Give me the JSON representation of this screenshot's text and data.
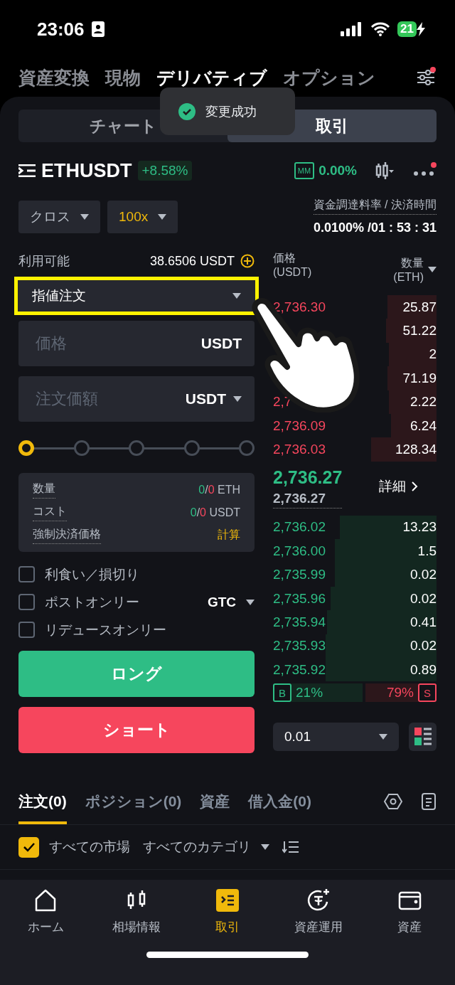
{
  "status_bar": {
    "time": "23:06",
    "battery": "21"
  },
  "top_tabs": [
    {
      "label": "資産変換",
      "selected": false
    },
    {
      "label": "現物",
      "selected": false
    },
    {
      "label": "デリバティブ",
      "selected": true
    },
    {
      "label": "オプション",
      "selected": false
    }
  ],
  "view_tabs": [
    {
      "label": "チャート",
      "selected": false
    },
    {
      "label": "取引",
      "selected": true
    }
  ],
  "toast": {
    "text": "変更成功"
  },
  "symbol": {
    "name": "ETHUSDT",
    "change": "+8.58%",
    "mm_badge": "MM",
    "mm_rate": "0.00%"
  },
  "margin_mode": "クロス",
  "leverage": "100x",
  "funding": {
    "label": "資金調達料率 / 決済時間",
    "value": "0.0100% /01 : 53 : 31"
  },
  "available": {
    "label": "利用可能",
    "value": "38.6506 USDT"
  },
  "order_type": "指値注文",
  "price_field": {
    "placeholder": "価格",
    "unit": "USDT"
  },
  "amount_field": {
    "placeholder": "注文価額",
    "unit": "USDT"
  },
  "slider": {
    "level": 0
  },
  "summary": [
    {
      "kind": "split",
      "label": "数量",
      "filled": "0",
      "sep": "/",
      "total": "0",
      "unit": "ETH"
    },
    {
      "kind": "split",
      "label": "コスト",
      "filled": "0",
      "sep": "/",
      "total": "0",
      "unit": "USDT"
    },
    {
      "kind": "link",
      "label": "強制決済価格",
      "value": "計算"
    }
  ],
  "options": [
    {
      "label": "利食い／損切り",
      "checked": false
    },
    {
      "label": "ポストオンリー",
      "checked": false
    },
    {
      "label": "リデュースオンリー",
      "checked": false
    }
  ],
  "time_in_force": "GTC",
  "buttons": [
    {
      "kind": "buy",
      "label": "ロング"
    },
    {
      "kind": "sell",
      "label": "ショート"
    }
  ],
  "order_book": {
    "price_header": "価格",
    "price_unit": "(USDT)",
    "qty_header": "数量",
    "qty_unit": "(ETH)",
    "asks": [
      {
        "price": "2,736.30",
        "qty": "25.87"
      },
      {
        "qty": "51.22"
      },
      {
        "qty": "2"
      },
      {
        "qty": "71.19"
      },
      {
        "price": "2,7",
        "qty": "2.22"
      },
      {
        "price": "2,736.09",
        "qty": "6.24"
      },
      {
        "price": "2,736.03",
        "qty": "128.34"
      }
    ],
    "last_price": "2,736.27",
    "mark_price": "2,736.27",
    "detail": "詳細",
    "bids": [
      {
        "price": "2,736.02",
        "qty": "13.23"
      },
      {
        "price": "2,736.00",
        "qty": "1.5"
      },
      {
        "price": "2,735.99",
        "qty": "0.02"
      },
      {
        "price": "2,735.96",
        "qty": "0.02"
      },
      {
        "price": "2,735.94",
        "qty": "0.41"
      },
      {
        "price": "2,735.93",
        "qty": "0.02"
      },
      {
        "price": "2,735.92",
        "qty": "0.89"
      }
    ],
    "buy_label": "B",
    "buy_ratio": "21%",
    "sell_ratio": "79%",
    "sell_label": "S",
    "precision": "0.01"
  },
  "bottom_tabs": [
    {
      "label": "注文(0)",
      "selected": true
    },
    {
      "label": "ポジション(0)",
      "selected": false
    },
    {
      "label": "資産",
      "selected": false
    },
    {
      "label": "借入金(0)",
      "selected": false
    }
  ],
  "filter": {
    "all_markets": {
      "label": "すべての市場",
      "checked": true
    },
    "category": "すべてのカテゴリ"
  },
  "nav": [
    {
      "kind": "home",
      "label": "ホーム",
      "selected": false
    },
    {
      "kind": "markets",
      "label": "相場情報",
      "selected": false
    },
    {
      "kind": "trade",
      "label": "取引",
      "selected": true
    },
    {
      "kind": "earn",
      "label": "資産運用",
      "selected": false
    },
    {
      "kind": "wallet",
      "label": "資産",
      "selected": false
    }
  ]
}
